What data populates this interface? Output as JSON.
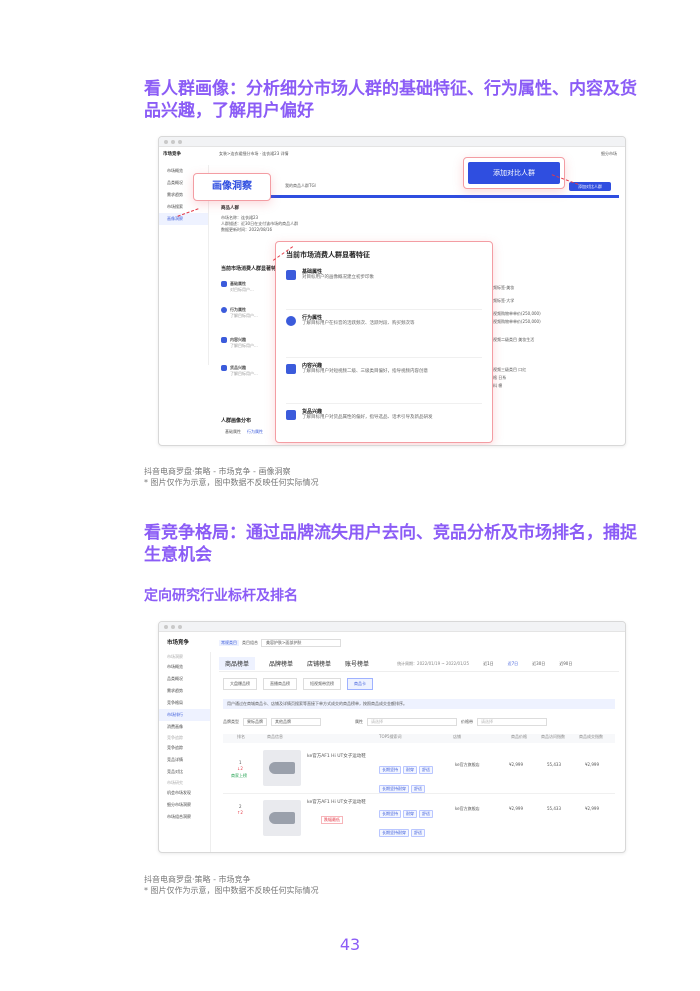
{
  "section1": {
    "heading": "看人群画像：分析细分市场人群的基础特征、行为属性、内容及货品兴趣，了解用户偏好",
    "caption_line1": "抖音电商罗盘·策略 - 市场竞争 - 画像洞察",
    "caption_line2": "* 图片仅作为示意，图中数据不反映任何实际情况"
  },
  "section2": {
    "heading": "看竞争格局：通过品牌流失用户去向、竞品分析及市场排名，捕捉生意机会",
    "subheading": "定向研究行业标杆及排名",
    "caption_line1": "抖音电商罗盘·策略 - 市场竞争",
    "caption_line2": "* 图片仅作为示意，图中数据不反映任何实际情况"
  },
  "page_number": "43",
  "shot1": {
    "title": "市场竞争",
    "breadcrumb": "女装>连衣裙细分市场 · 连衣裙23 详情",
    "top_right": "细分市场",
    "sidebar": [
      "市场概览",
      "品类概况",
      "需求趋势",
      "市场搜索",
      "画像洞察"
    ],
    "sidebar_selected": "画像洞察",
    "callout_portrait": "画像洞察",
    "callout_add": "添加对比人群",
    "add_button": "添加对比人群",
    "crowd_label": "我的商品人群TGI",
    "crowd_section": "商品人群",
    "info_rows": [
      "市场名称：连衣裙23",
      "人群描述：近30日在支付该市场的商品人群",
      "数据更新时间：2022/08/16"
    ],
    "panel_title": "当前市场消费人群显著特征",
    "features": [
      {
        "title": "基础属性",
        "desc": "对目标用户的画像概况建立初步印象"
      },
      {
        "title": "行为属性",
        "desc": "了解目标用户在抖音的活跃频次、活跃时段、购买频次等"
      },
      {
        "title": "内容兴趣",
        "desc": "了解目标用户对短视频二级、三级类目偏好，指导视频内容创意"
      },
      {
        "title": "货品兴趣",
        "desc": "了解目标用户对货品属性的偏好，指导选品、话术引导及新品研发"
      }
    ],
    "bg_section": "当前市场消费人群显著特征",
    "bg_rows": [
      {
        "title": "基础属性",
        "sub": "对目标用户..."
      },
      {
        "title": "行为属性",
        "sub": "了解目标用户..."
      },
      {
        "title": "内容兴趣",
        "sub": "了解目标用户..."
      },
      {
        "title": "货品兴趣",
        "sub": "了解目标用户..."
      }
    ],
    "right_col": [
      "视频标签·美妆",
      "视频标签·大学",
      "短视频购物单单价(250,000)",
      "短视频购物单单价(250,000)",
      "短视频二级类目 美妆生活",
      "短视频三级类目 口红",
      "风格 日系",
      "面料 棉"
    ],
    "portrait_dist": "人群画像分布",
    "dist_tabs": [
      "基础属性",
      "行为属性"
    ]
  },
  "shot2": {
    "title": "市场竞争",
    "sidebar": [
      "市场概览",
      "品类概况",
      "需求趋势",
      "竞争格局",
      "市场排行",
      "消费画像",
      "竞争追踪",
      "竞品详情",
      "竞品对比",
      "机会市场发现",
      "细分市场洞察",
      "市场组合洞察"
    ],
    "sidebar_selected": "市场排行",
    "sidebar_groups": [
      "市场洞察",
      "竞争追踪",
      "市场研究"
    ],
    "filter_tabs": [
      "常规类目",
      "类目组合"
    ],
    "category": "美容护肤>面部护肤",
    "tabs": [
      "商品榜单",
      "品牌榜单",
      "店铺榜单",
      "账号榜单"
    ],
    "date_label": "统计周期：2022/01/19 ~ 2022/01/25",
    "date_options": [
      "近1日",
      "近7日",
      "近30日",
      "近90日"
    ],
    "date_selected": "近7日",
    "subtabs": [
      "大盘爆品榜",
      "直播商品榜",
      "短视频带货榜",
      "商品卡"
    ],
    "notice": "用户通过在商城商品卡、店铺及详情页搜索等直接下单方式成交的商品榜单，按照商品成交金额排序。",
    "filter_brand_type": "品牌类型",
    "filter_brand_value": "果标品牌",
    "filter_other": "其他品牌",
    "filter_attr": "属性",
    "filter_price": "价格带",
    "filter_placeholder": "请选择",
    "columns": [
      "排名",
      "商品信息",
      "TOP5搜索词",
      "店铺",
      "商品价格",
      "商品访问指数",
      "商品成交指数"
    ],
    "rows": [
      {
        "rank": "1",
        "rank_sub": "↓2",
        "badge": "商家上榜",
        "name": "ke官方AF1 Hi UT女子运动鞋",
        "tags": [
          "长期坚持",
          "耐穿",
          "舒适",
          "长期坚持耐穿",
          "舒适"
        ],
        "store": "ke官方旗舰店",
        "price": "¥2,999",
        "visit": "55,433",
        "deal": "¥2,999"
      },
      {
        "rank": "2",
        "rank_sub": "↑2",
        "badge": "跌幅最低",
        "name": "ke官方AF1 Hi UT女子运动鞋",
        "tags": [
          "长期坚持",
          "耐穿",
          "舒适",
          "长期坚持耐穿",
          "舒适"
        ],
        "store": "ke官方旗舰店",
        "price": "¥2,999",
        "visit": "55,433",
        "deal": "¥2,999"
      }
    ]
  }
}
